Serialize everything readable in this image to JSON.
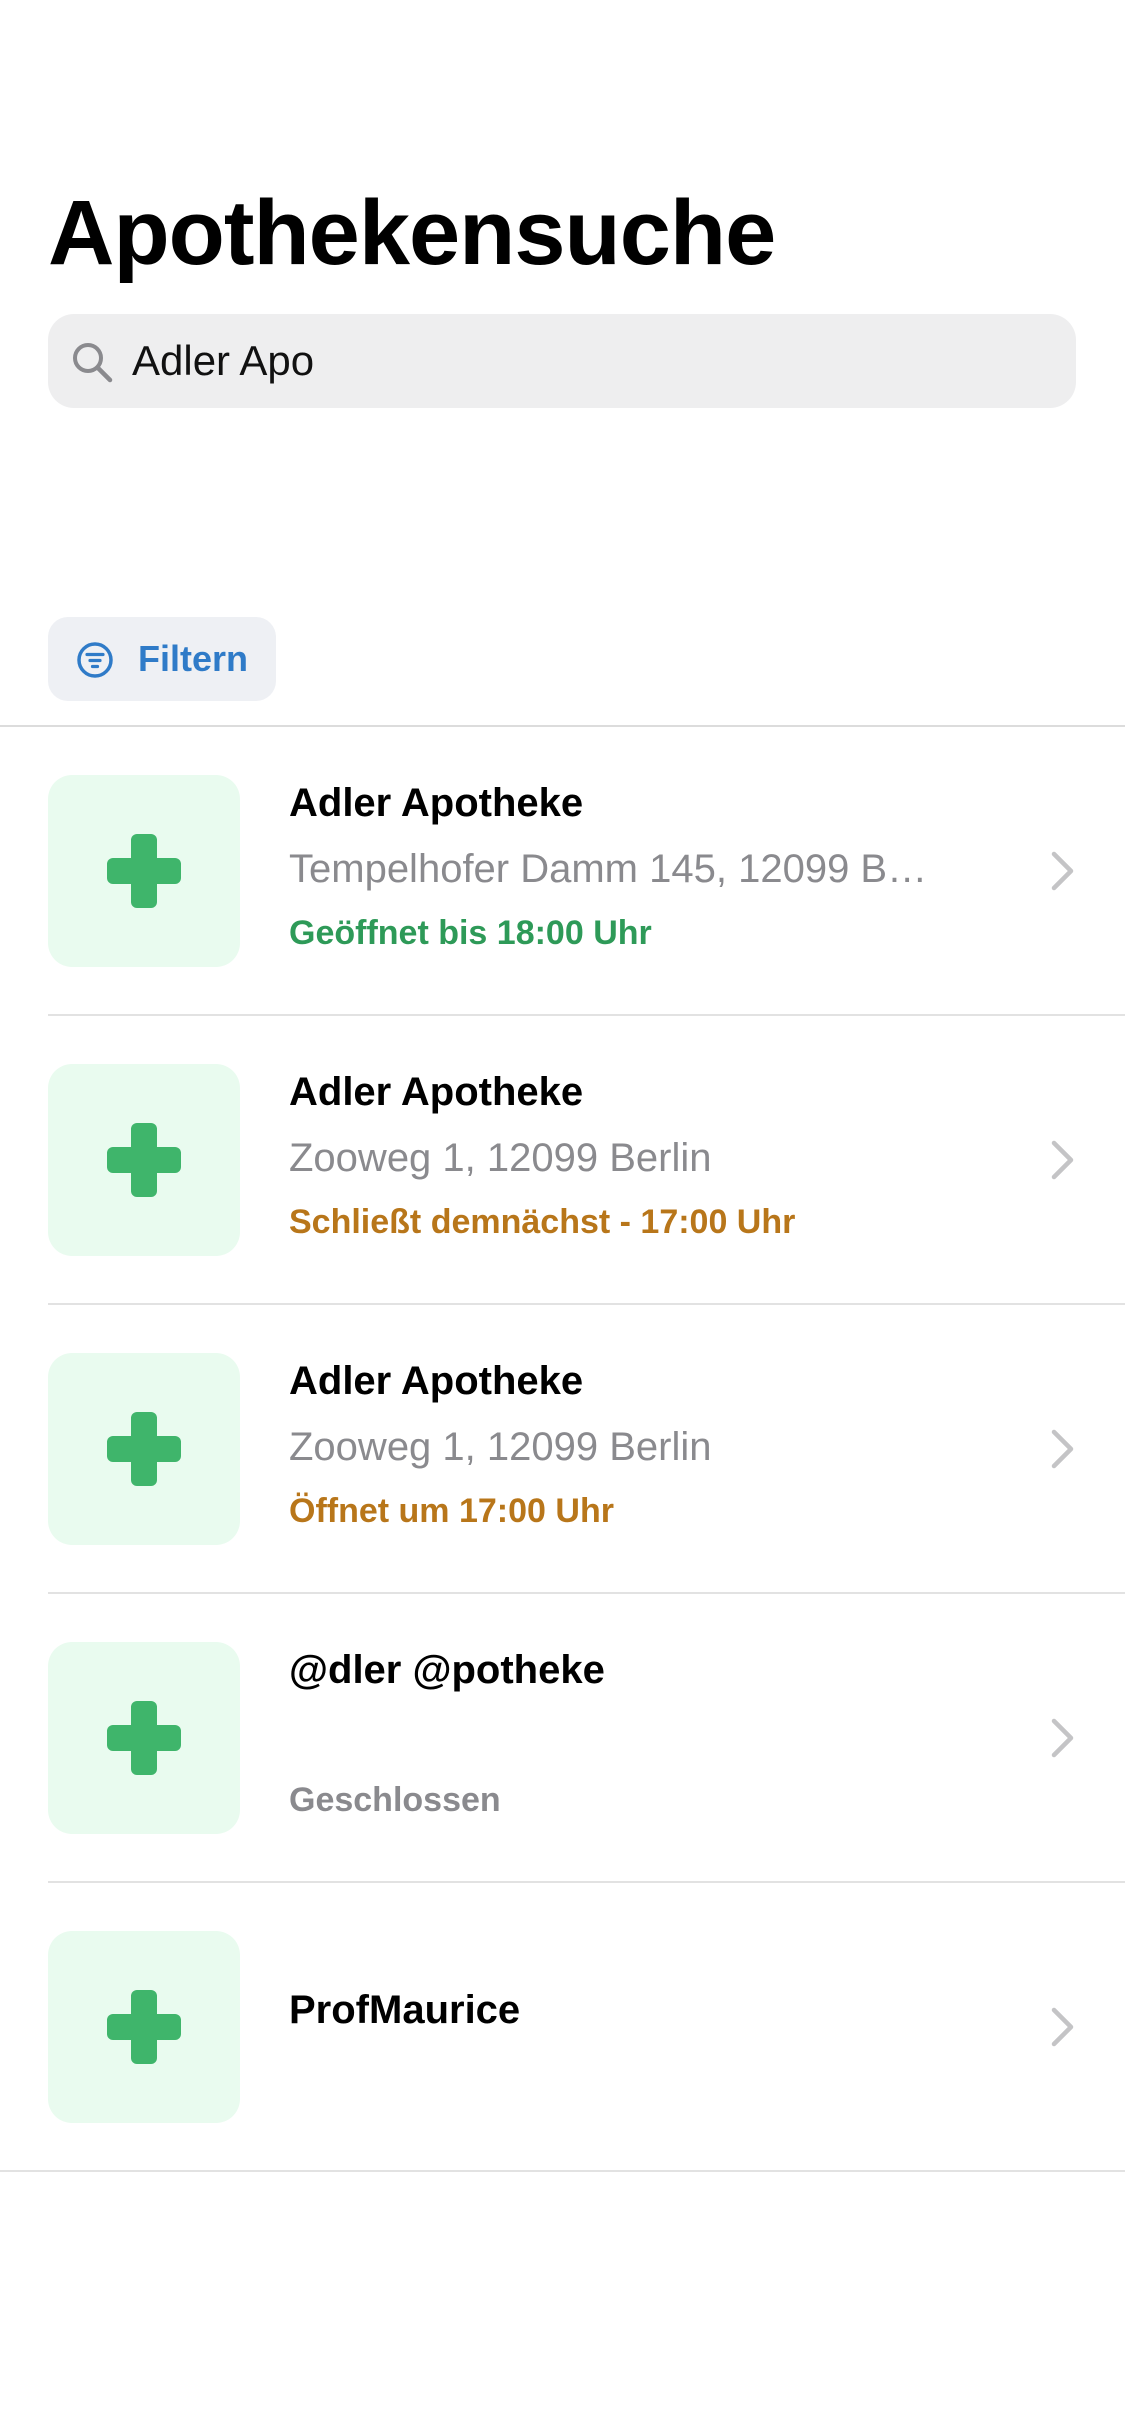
{
  "header": {
    "title": "Apothekensuche"
  },
  "search": {
    "value": "Adler Apo"
  },
  "filter": {
    "label": "Filtern"
  },
  "colors": {
    "accent_blue": "#2f7bc8",
    "green": "#3fb56b",
    "open_green": "#2e9a58",
    "warning_orange": "#b8761a",
    "closed_gray": "#8a8a8e"
  },
  "pharmacies": [
    {
      "name": "Adler Apotheke",
      "address": "Tempelhofer Damm 145, 12099 Berlin",
      "status": "Geöffnet bis 18:00 Uhr",
      "status_type": "open"
    },
    {
      "name": "Adler Apotheke",
      "address": "Zooweg 1, 12099 Berlin",
      "status": "Schließt demnächst - 17:00 Uhr",
      "status_type": "closing"
    },
    {
      "name": "Adler Apotheke",
      "address": "Zooweg 1, 12099 Berlin",
      "status": "Öffnet um 17:00 Uhr",
      "status_type": "opening"
    },
    {
      "name": "@dler @potheke",
      "address": "",
      "status": "Geschlossen",
      "status_type": "closed"
    },
    {
      "name": "ProfMaurice",
      "address": "",
      "status": "",
      "status_type": "none"
    }
  ],
  "icons": {
    "search": "magnifier-icon",
    "filter": "filter-circle-icon",
    "pharmacy": "pharmacy-cross-icon",
    "chevron": "chevron-right-icon"
  }
}
